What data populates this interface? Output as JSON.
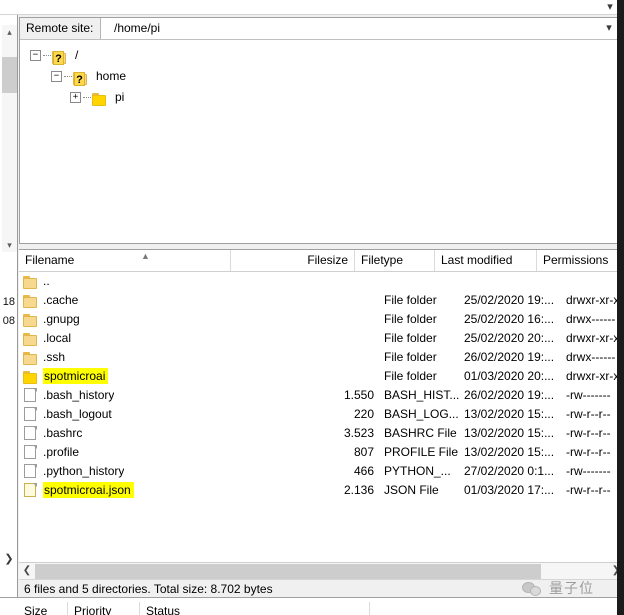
{
  "window": {
    "top_dropdown_icon": "chevron-down-icon"
  },
  "left_edge": {
    "scroll_up_icon": "chevron-up-icon",
    "scroll_down_icon": "chevron-down-icon",
    "clipped_texts": [
      "18",
      "08"
    ],
    "bottom_arrow_icon": "chevron-right-icon"
  },
  "remote_site": {
    "label": "Remote site:",
    "path": "/home/pi",
    "dropdown_icon": "chevron-down-icon"
  },
  "tree": {
    "nodes": [
      {
        "label": "/",
        "indent": 0,
        "expander": "−",
        "icon": "folder-unknown-icon",
        "has_question": true
      },
      {
        "label": "home",
        "indent": 1,
        "expander": "−",
        "icon": "folder-unknown-icon",
        "has_question": true
      },
      {
        "label": "pi",
        "indent": 2,
        "expander": "+",
        "icon": "folder-icon",
        "has_question": false
      }
    ]
  },
  "file_list": {
    "columns": [
      {
        "key": "name",
        "label": "Filename",
        "align": "left"
      },
      {
        "key": "size",
        "label": "Filesize",
        "align": "right"
      },
      {
        "key": "type",
        "label": "Filetype",
        "align": "left"
      },
      {
        "key": "modified",
        "label": "Last modified",
        "align": "left"
      },
      {
        "key": "permissions",
        "label": "Permissions",
        "align": "left"
      }
    ],
    "sort_indicator": "sort-ascending-icon",
    "rows": [
      {
        "name": "..",
        "size": "",
        "type": "",
        "modified": "",
        "permissions": "",
        "icon": "folder-icon",
        "highlighted": false
      },
      {
        "name": ".cache",
        "size": "",
        "type": "File folder",
        "modified": "25/02/2020 19:...",
        "permissions": "drwxr-xr-x",
        "icon": "folder-icon",
        "highlighted": false
      },
      {
        "name": ".gnupg",
        "size": "",
        "type": "File folder",
        "modified": "25/02/2020 16:...",
        "permissions": "drwx------",
        "icon": "folder-icon",
        "highlighted": false
      },
      {
        "name": ".local",
        "size": "",
        "type": "File folder",
        "modified": "25/02/2020 20:...",
        "permissions": "drwxr-xr-x",
        "icon": "folder-icon",
        "highlighted": false
      },
      {
        "name": ".ssh",
        "size": "",
        "type": "File folder",
        "modified": "26/02/2020 19:...",
        "permissions": "drwx------",
        "icon": "folder-icon",
        "highlighted": false
      },
      {
        "name": "spotmicroai",
        "size": "",
        "type": "File folder",
        "modified": "01/03/2020 20:...",
        "permissions": "drwxr-xr-x",
        "icon": "folder-icon",
        "highlighted": true
      },
      {
        "name": ".bash_history",
        "size": "1.550",
        "type": "BASH_HIST...",
        "modified": "26/02/2020 19:...",
        "permissions": "-rw-------",
        "icon": "document-icon",
        "highlighted": false
      },
      {
        "name": ".bash_logout",
        "size": "220",
        "type": "BASH_LOG...",
        "modified": "13/02/2020 15:...",
        "permissions": "-rw-r--r--",
        "icon": "document-icon",
        "highlighted": false
      },
      {
        "name": ".bashrc",
        "size": "3.523",
        "type": "BASHRC File",
        "modified": "13/02/2020 15:...",
        "permissions": "-rw-r--r--",
        "icon": "document-icon",
        "highlighted": false
      },
      {
        "name": ".profile",
        "size": "807",
        "type": "PROFILE File",
        "modified": "13/02/2020 15:...",
        "permissions": "-rw-r--r--",
        "icon": "document-icon",
        "highlighted": false
      },
      {
        "name": ".python_history",
        "size": "466",
        "type": "PYTHON_...",
        "modified": "27/02/2020 0:1...",
        "permissions": "-rw-------",
        "icon": "document-icon",
        "highlighted": false
      },
      {
        "name": "spotmicroai.json",
        "size": "2.136",
        "type": "JSON File",
        "modified": "01/03/2020 17:...",
        "permissions": "-rw-r--r--",
        "icon": "json-document-icon",
        "highlighted": true
      }
    ]
  },
  "hscroll": {
    "left_icon": "chevron-left-icon",
    "right_icon": "chevron-right-icon"
  },
  "status_bar": {
    "text": "6 files and 5 directories. Total size: 8.702 bytes",
    "watermark": {
      "icon": "wechat-icon",
      "text": "量子位"
    }
  },
  "queue_bar": {
    "columns": [
      "Size",
      "Priority",
      "Status"
    ]
  },
  "colors": {
    "highlight": "#ffff00",
    "folder": "#f6d98f",
    "border": "#a0a0a0"
  }
}
